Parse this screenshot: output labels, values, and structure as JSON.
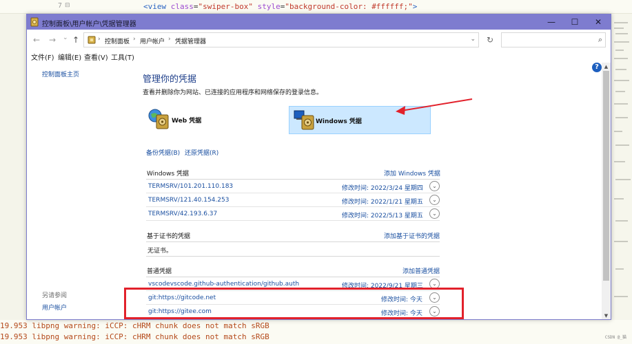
{
  "editor": {
    "line_number": "7",
    "fold_marker": "⊟",
    "code_parts": {
      "open": "<view ",
      "attr1": "class",
      "eq1": "=",
      "val1": "\"swiper-box\"",
      "sp": " ",
      "attr2": "style",
      "eq2": "=",
      "val2": "\"background-color: #ffffff;\"",
      "close": ">"
    },
    "terminal_lines": [
      "19.953 libpng warning: iCCP: cHRM chunk does not match sRGB",
      "19.953 libpng warning: iCCP: cHRM chunk does not match sRGB"
    ],
    "watermark": "CSDN @_猫"
  },
  "window": {
    "title": "控制面板\\用户帐户\\凭据管理器",
    "controls": {
      "minimize": "—",
      "maximize": "☐",
      "close": "✕"
    },
    "nav": {
      "back": "←",
      "forward": "→",
      "recent": "⌄",
      "up": "↑"
    },
    "address": {
      "crumbs": [
        "控制面板",
        "用户帐户",
        "凭据管理器"
      ],
      "sep": "›",
      "dropdown": "⌄",
      "refresh": "↻"
    },
    "search": {
      "placeholder": "",
      "icon": "⌕"
    },
    "menu": [
      "文件(F)",
      "编辑(E)",
      "查看(V)",
      "工具(T)"
    ]
  },
  "sidebar": {
    "home_link": "控制面板主页",
    "see_also_label": "另请参阅",
    "see_also_link": "用户帐户"
  },
  "main": {
    "help": "?",
    "title": "管理你的凭据",
    "description": "查看并删除你为网站、已连接的应用程序和网络保存的登录信息。",
    "types": [
      {
        "label": "Web 凭据",
        "selected": false
      },
      {
        "label": "Windows 凭据",
        "selected": true
      }
    ],
    "backup_link": "备份凭据(B)",
    "restore_link": "还原凭据(R)",
    "windows_section": {
      "title": "Windows 凭据",
      "add": "添加 Windows 凭据",
      "rows": [
        {
          "name": "TERMSRV/101.201.110.183",
          "modified": "修改时间:  2022/3/24 星期四"
        },
        {
          "name": "TERMSRV/121.40.154.253",
          "modified": "修改时间:  2022/1/21 星期五"
        },
        {
          "name": "TERMSRV/42.193.6.37",
          "modified": "修改时间:  2022/5/13 星期五"
        }
      ]
    },
    "cert_section": {
      "title": "基于证书的凭据",
      "add": "添加基于证书的凭据",
      "empty": "无证书。"
    },
    "generic_section": {
      "title": "普通凭据",
      "add": "添加普通凭据",
      "rows": [
        {
          "name": "vscodevscode.github-authentication/github.auth",
          "modified": "修改时间:  2022/9/21 星期三"
        },
        {
          "name": "git:https://gitcode.net",
          "modified": "修改时间:  今天"
        },
        {
          "name": "git:https://gitee.com",
          "modified": "修改时间:  今天"
        }
      ]
    },
    "expand_glyph": "⌄"
  },
  "colors": {
    "link": "#1a4fa0",
    "title_bar": "#7e7ccf",
    "selected_bg": "#cce8ff",
    "annotation": "#e2212b"
  }
}
